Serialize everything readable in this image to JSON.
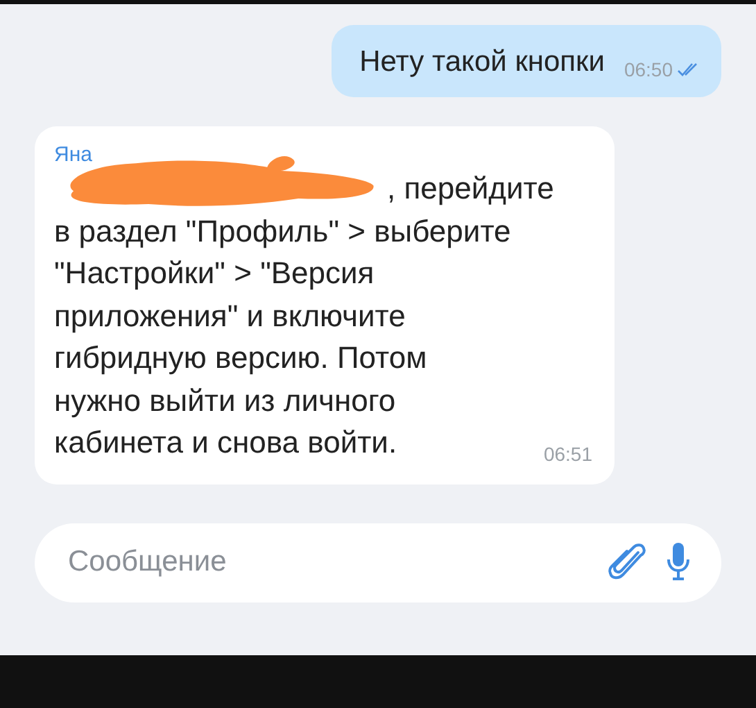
{
  "messages": [
    {
      "kind": "outgoing",
      "text": "Нету такой кнопки",
      "time": "06:50",
      "read": true
    },
    {
      "kind": "incoming",
      "sender": "Яна",
      "redacted": true,
      "lines": [
        ", перейдите",
        "в раздел \"Профиль\" > выберите",
        "\"Настройки\" > \"Версия",
        "приложения\" и включите",
        "гибридную версию. Потом",
        "нужно выйти из личного",
        "кабинета и снова войти."
      ],
      "time": "06:51"
    }
  ],
  "composer": {
    "placeholder": "Сообщение"
  }
}
